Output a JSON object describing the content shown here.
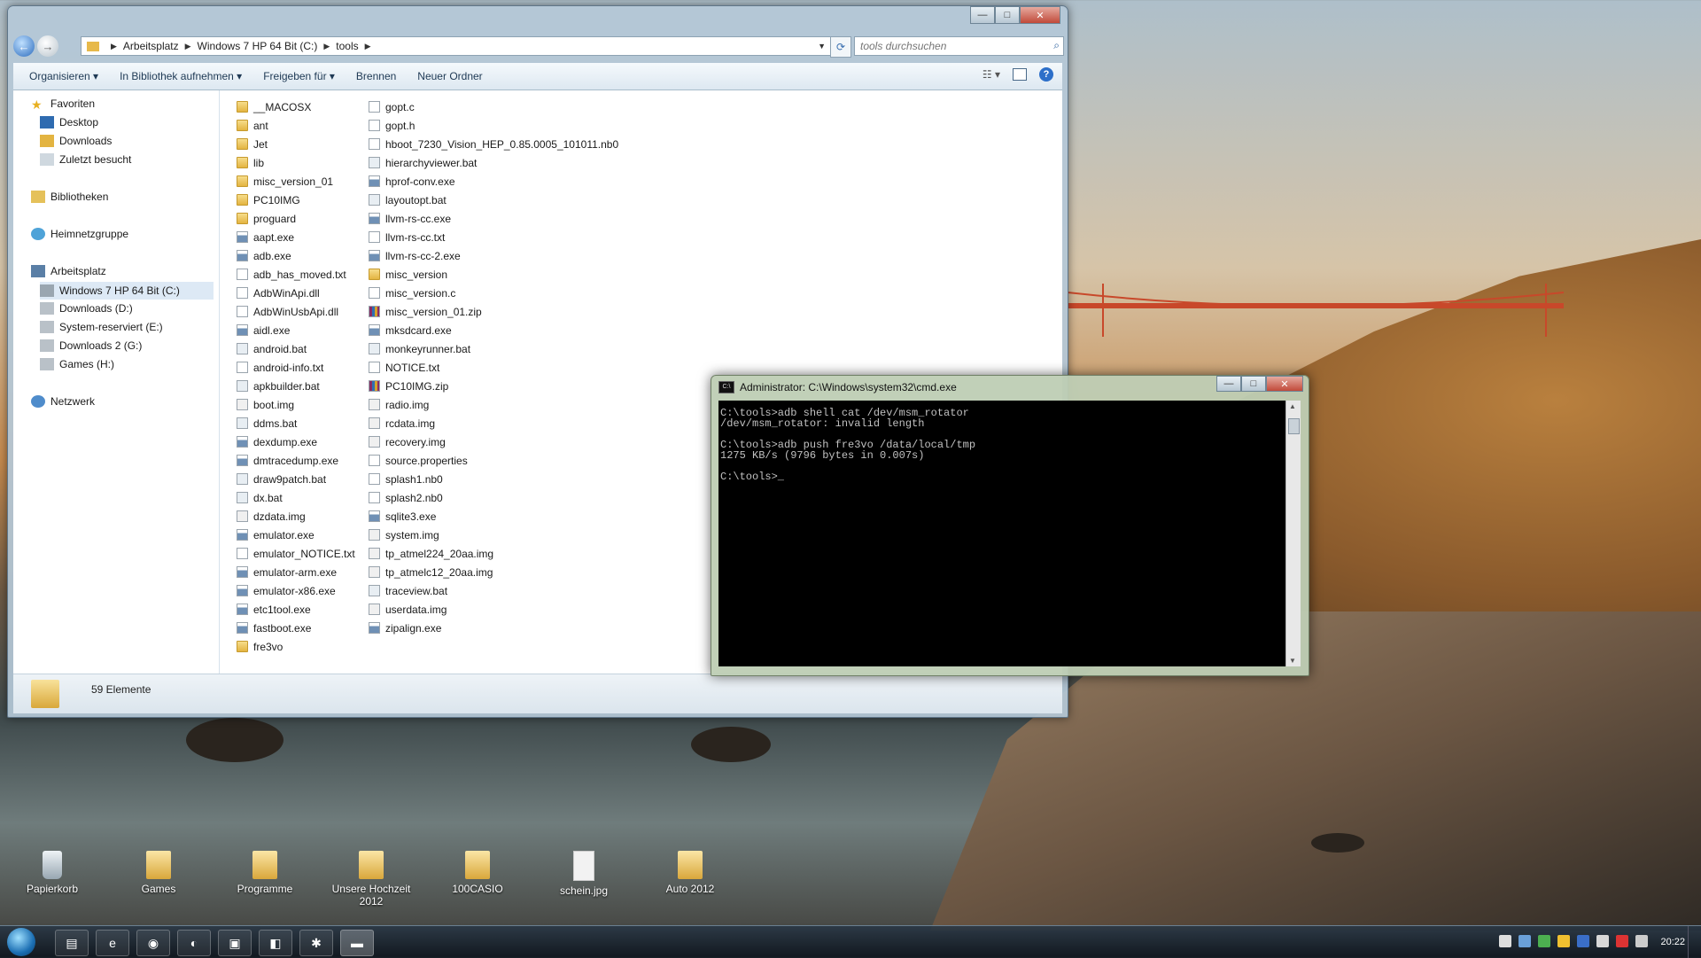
{
  "explorer": {
    "breadcrumb": [
      "Arbeitsplatz",
      "Windows 7 HP 64 Bit (C:)",
      "tools"
    ],
    "search_placeholder": "tools durchsuchen",
    "toolbar": {
      "organize": "Organisieren",
      "library": "In Bibliothek aufnehmen",
      "share": "Freigeben für",
      "burn": "Brennen",
      "new_folder": "Neuer Ordner"
    },
    "nav": {
      "favorites": "Favoriten",
      "desktop": "Desktop",
      "downloads": "Downloads",
      "recent": "Zuletzt besucht",
      "libraries": "Bibliotheken",
      "homegroup": "Heimnetzgruppe",
      "computer": "Arbeitsplatz",
      "drive_c": "Windows 7 HP 64 Bit (C:)",
      "drive_d": "Downloads (D:)",
      "drive_e": "System-reserviert (E:)",
      "drive_g": "Downloads 2 (G:)",
      "drive_h": "Games (H:)",
      "network": "Netzwerk"
    },
    "files_col1": [
      "__MACOSX",
      "ant",
      "Jet",
      "lib",
      "misc_version_01",
      "PC10IMG",
      "proguard",
      "aapt.exe",
      "adb.exe",
      "adb_has_moved.txt",
      "AdbWinApi.dll",
      "AdbWinUsbApi.dll",
      "aidl.exe",
      "android.bat",
      "android-info.txt",
      "apkbuilder.bat",
      "boot.img",
      "ddms.bat",
      "dexdump.exe",
      "dmtracedump.exe",
      "draw9patch.bat",
      "dx.bat",
      "dzdata.img",
      "emulator.exe",
      "emulator_NOTICE.txt",
      "emulator-arm.exe",
      "emulator-x86.exe",
      "etc1tool.exe",
      "fastboot.exe",
      "fre3vo"
    ],
    "files_col2": [
      "gopt.c",
      "gopt.h",
      "hboot_7230_Vision_HEP_0.85.0005_101011.nb0",
      "hierarchyviewer.bat",
      "hprof-conv.exe",
      "layoutopt.bat",
      "llvm-rs-cc.exe",
      "llvm-rs-cc.txt",
      "llvm-rs-cc-2.exe",
      "misc_version",
      "misc_version.c",
      "misc_version_01.zip",
      "mksdcard.exe",
      "monkeyrunner.bat",
      "NOTICE.txt",
      "PC10IMG.zip",
      "radio.img",
      "rcdata.img",
      "recovery.img",
      "source.properties",
      "splash1.nb0",
      "splash2.nb0",
      "sqlite3.exe",
      "system.img",
      "tp_atmel224_20aa.img",
      "tp_atmelc12_20aa.img",
      "traceview.bat",
      "userdata.img",
      "zipalign.exe"
    ],
    "status": "59 Elemente"
  },
  "cmd": {
    "title": "Administrator: C:\\Windows\\system32\\cmd.exe",
    "lines": [
      "C:\\tools>adb shell cat /dev/msm_rotator",
      "/dev/msm_rotator: invalid length",
      "",
      "C:\\tools>adb push fre3vo /data/local/tmp",
      "1275 KB/s (9796 bytes in 0.007s)",
      "",
      "C:\\tools>_"
    ]
  },
  "desktop": {
    "icons": [
      "Papierkorb",
      "Games",
      "Programme",
      "Unsere Hochzeit 2012",
      "100CASIO",
      "schein.jpg",
      "Auto 2012"
    ]
  },
  "taskbar": {
    "clock": "20:22"
  },
  "colors": {
    "accent": "#2b6bbd",
    "console_bg": "#000000",
    "console_fg": "#c0c0c0"
  }
}
